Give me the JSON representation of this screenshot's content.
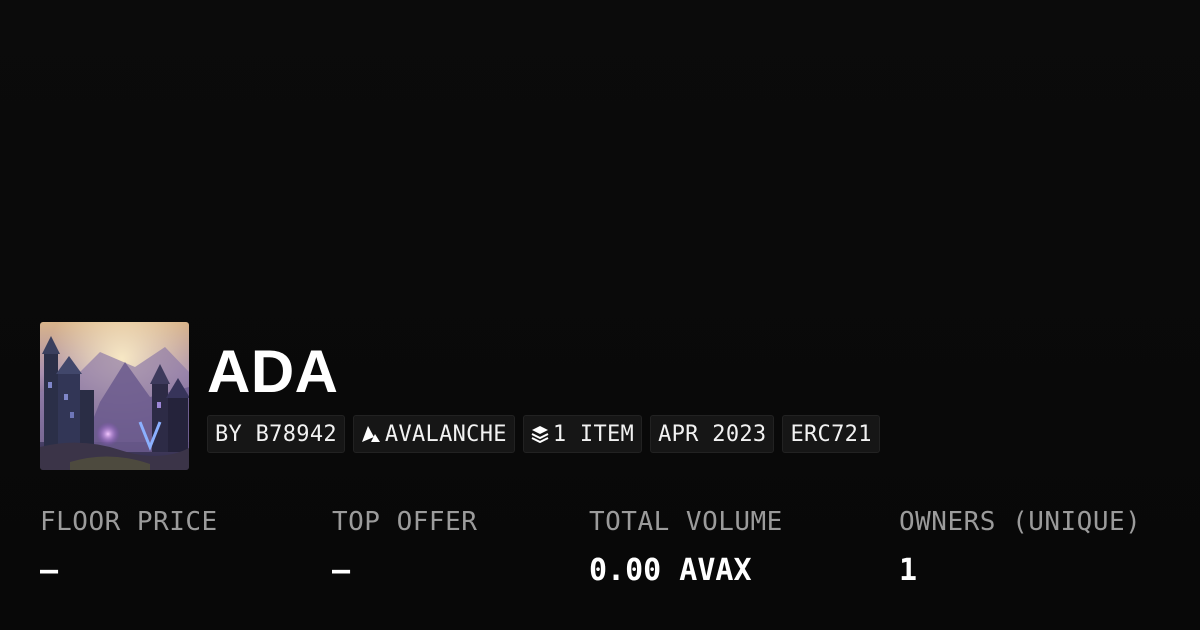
{
  "collection": {
    "name": "ADA",
    "image_alt": "collection artwork",
    "tags": {
      "creator": "BY B78942",
      "chain": "AVALANCHE",
      "items": "1 ITEM",
      "date": "APR 2023",
      "standard": "ERC721"
    },
    "icons": {
      "chain": "avalanche-logo-icon",
      "items": "layers-icon"
    }
  },
  "stats": {
    "floor_price": {
      "label": "FLOOR PRICE",
      "value": "–"
    },
    "top_offer": {
      "label": "TOP OFFER",
      "value": "–"
    },
    "total_volume": {
      "label": "TOTAL VOLUME",
      "value": "0.00 AVAX"
    },
    "owners": {
      "label": "OWNERS (UNIQUE)",
      "value": "1"
    }
  },
  "colors": {
    "background": "#0a0a0a",
    "label": "#9b9b9b",
    "value": "#ffffff",
    "tag_bg": "#161616"
  }
}
